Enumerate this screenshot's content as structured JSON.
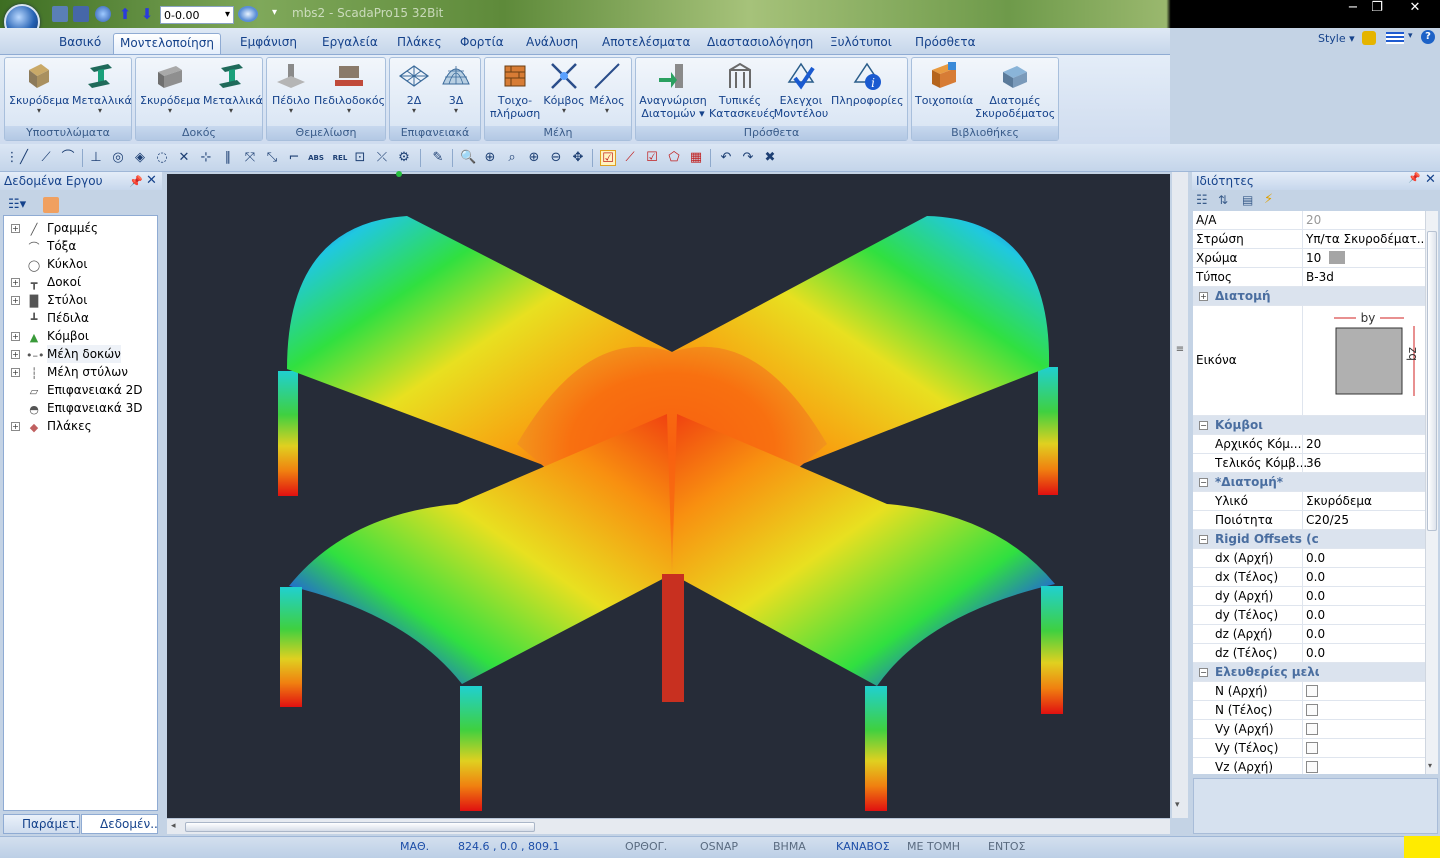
{
  "window": {
    "title": "mbs2 - ScadaPro15 32Bit",
    "qat_combo": "0-0.00",
    "min": "−",
    "max": "❐",
    "close": "✕"
  },
  "tabs": [
    "Βασικό",
    "Μοντελοποίηση",
    "Εμφάνιση",
    "Εργαλεία",
    "Πλάκες",
    "Φορτία",
    "Ανάλυση",
    "Αποτελέσματα",
    "Διαστασιολόγηση",
    "Ξυλότυποι",
    "Πρόσθετα"
  ],
  "active_tab": "Μοντελοποίηση",
  "style_label": "Style",
  "ribbon": {
    "groups": {
      "columns": "Υποστυλώματα",
      "beams": "Δοκός",
      "foundation": "Θεμελίωση",
      "surfaces": "Επιφανειακά",
      "members": "Μέλη",
      "addons": "Πρόσθετα",
      "libraries": "Βιβλιοθήκες"
    },
    "buttons": {
      "concrete_col": "Σκυρόδεμα",
      "steel_col": "Μεταλλικά",
      "concrete_beam": "Σκυρόδεμα",
      "steel_beam": "Μεταλλικά",
      "pedilo": "Πέδιλο",
      "pedilodokos": "Πεδιλοδοκός",
      "s2d": "2Δ",
      "s3d": "3Δ",
      "wall1": "Τοιχο-",
      "wall2": "πλήρωση",
      "node": "Κόμβος",
      "member": "Μέλος",
      "recog1": "Αναγνώριση",
      "recog2": "Διατομών",
      "typical1": "Τυπικές",
      "typical2": "Κατασκευές",
      "check1": "Ελεγχοι",
      "check2": "Μοντέλου",
      "info": "Πληροφορίες",
      "masonry": "Τοιχοποιία",
      "sections1": "Διατομές",
      "sections2": "Σκυροδέματος"
    }
  },
  "toolbar_labels": {
    "abs": "ABS",
    "rel": "REL"
  },
  "left_panel": {
    "title": "Δεδομένα Εργου",
    "tree": [
      "Γραμμές",
      "Τόξα",
      "Κύκλοι",
      "Δοκοί",
      "Στύλοι",
      "Πέδιλα",
      "Κόμβοι",
      "Μέλη δοκών",
      "Μέλη στύλων",
      "Επιφανειακά 2D",
      "Επιφανειακά 3D",
      "Πλάκες"
    ],
    "bottom_tabs": [
      "Παράμετ...",
      "Δεδομέν..."
    ]
  },
  "properties": {
    "title": "Ιδιότητες",
    "rows": {
      "aa": {
        "k": "Α/Α",
        "v": "20"
      },
      "layer": {
        "k": "Στρώση",
        "v": "Υπ/τα Σκυροδέματ..."
      },
      "color": {
        "k": "Χρώμα",
        "v": "10"
      },
      "type": {
        "k": "Τύπος",
        "v": "B-3d"
      },
      "cat_section": "Διατομή",
      "image": {
        "k": "Εικόνα"
      },
      "cat_nodes": "Κόμβοι",
      "start_node": {
        "k": "Αρχικός Κόμ...",
        "v": "20"
      },
      "end_node": {
        "k": "Τελικός Κόμβ...",
        "v": "36"
      },
      "cat_section2": "*Διατομή*",
      "material": {
        "k": "Υλικό",
        "v": "Σκυρόδεμα"
      },
      "quality": {
        "k": "Ποιότητα",
        "v": "C20/25"
      },
      "cat_rigid": "Rigid Offsets (cm)",
      "dx_start": {
        "k": "dx (Αρχή)",
        "v": "0.0"
      },
      "dx_end": {
        "k": "dx (Τέλος)",
        "v": "0.0"
      },
      "dy_start": {
        "k": "dy (Αρχή)",
        "v": "0.0"
      },
      "dy_end": {
        "k": "dy (Τέλος)",
        "v": "0.0"
      },
      "dz_start": {
        "k": "dz (Αρχή)",
        "v": "0.0"
      },
      "dz_end": {
        "k": "dz (Τέλος)",
        "v": "0.0"
      },
      "cat_free": "Ελευθερίες μελών",
      "n_start": {
        "k": "N (Αρχή)"
      },
      "n_end": {
        "k": "N (Τέλος)"
      },
      "vy_start": {
        "k": "Vy (Αρχή)"
      },
      "vy_end": {
        "k": "Vy (Τέλος)"
      },
      "vz_start": {
        "k": "Vz (Αρχή)"
      }
    },
    "section_dims": {
      "by": "by",
      "bz": "bz"
    }
  },
  "status": {
    "math": "ΜΑΘ.",
    "coords": "824.6 , 0.0 , 809.1",
    "ortho": "ΟΡΘΟΓ.",
    "osnap": "OSNAP",
    "step": "ΒΗΜΑ",
    "grid": "ΚΑΝΑΒΟΣ",
    "intersect": "ΜΕ ΤΟΜΗ",
    "within": "ΕΝΤΟΣ"
  },
  "colors": {
    "accent": "#15428b",
    "viewport": "#262c38",
    "status_on": "#1d4ea8"
  }
}
